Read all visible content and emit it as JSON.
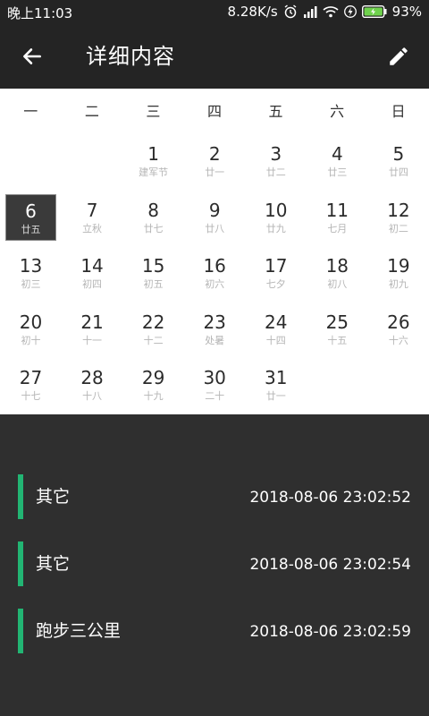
{
  "status_bar": {
    "time": "晚上11:03",
    "speed": "8.28K/s",
    "battery": "93%",
    "icons": [
      "alarm-icon",
      "signal-icon",
      "wifi-icon",
      "charging-icon",
      "battery-icon"
    ]
  },
  "appbar": {
    "title": "详细内容",
    "back_icon": "arrow-left-icon",
    "edit_icon": "pencil-icon"
  },
  "calendar": {
    "weekdays": [
      "一",
      "二",
      "三",
      "四",
      "五",
      "六",
      "日"
    ],
    "selected_day": "6",
    "weeks": [
      [
        null,
        null,
        {
          "day": "1",
          "lunar": "建军节"
        },
        {
          "day": "2",
          "lunar": "廿一"
        },
        {
          "day": "3",
          "lunar": "廿二"
        },
        {
          "day": "4",
          "lunar": "廿三"
        },
        {
          "day": "5",
          "lunar": "廿四"
        }
      ],
      [
        {
          "day": "6",
          "lunar": "廿五"
        },
        {
          "day": "7",
          "lunar": "立秋"
        },
        {
          "day": "8",
          "lunar": "廿七"
        },
        {
          "day": "9",
          "lunar": "廿八"
        },
        {
          "day": "10",
          "lunar": "廿九"
        },
        {
          "day": "11",
          "lunar": "七月"
        },
        {
          "day": "12",
          "lunar": "初二"
        }
      ],
      [
        {
          "day": "13",
          "lunar": "初三"
        },
        {
          "day": "14",
          "lunar": "初四"
        },
        {
          "day": "15",
          "lunar": "初五"
        },
        {
          "day": "16",
          "lunar": "初六"
        },
        {
          "day": "17",
          "lunar": "七夕"
        },
        {
          "day": "18",
          "lunar": "初八"
        },
        {
          "day": "19",
          "lunar": "初九"
        }
      ],
      [
        {
          "day": "20",
          "lunar": "初十"
        },
        {
          "day": "21",
          "lunar": "十一"
        },
        {
          "day": "22",
          "lunar": "十二"
        },
        {
          "day": "23",
          "lunar": "处暑"
        },
        {
          "day": "24",
          "lunar": "十四"
        },
        {
          "day": "25",
          "lunar": "十五"
        },
        {
          "day": "26",
          "lunar": "十六"
        }
      ],
      [
        {
          "day": "27",
          "lunar": "十七"
        },
        {
          "day": "28",
          "lunar": "十八"
        },
        {
          "day": "29",
          "lunar": "十九"
        },
        {
          "day": "30",
          "lunar": "二十"
        },
        {
          "day": "31",
          "lunar": "廿一"
        },
        null,
        null
      ]
    ]
  },
  "records": [
    {
      "name": "其它",
      "timestamp": "2018-08-06 23:02:52"
    },
    {
      "name": "其它",
      "timestamp": "2018-08-06 23:02:54"
    },
    {
      "name": "跑步三公里",
      "timestamp": "2018-08-06 23:02:59"
    }
  ],
  "colors": {
    "accent": "#22b573",
    "appbar": "#242424",
    "background": "#2f2f2f"
  }
}
